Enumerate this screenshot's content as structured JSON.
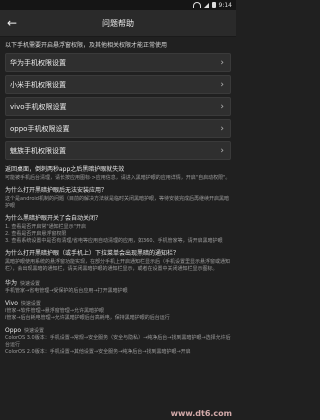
{
  "statusbar": {
    "time": "9:14"
  },
  "appbar": {
    "title": "问题帮助"
  },
  "intro": "以下手机需要开启悬浮窗权限，及其他相关权限才能正常使用",
  "settings": [
    {
      "label": "华为手机权限设置"
    },
    {
      "label": "小米手机权限设置"
    },
    {
      "label": "vivo手机权限设置"
    },
    {
      "label": "oppo手机权限设置"
    },
    {
      "label": "魅族手机权限设置"
    }
  ],
  "faq": [
    {
      "q": "返回桌面，倒刺两秒app之后黑暗护眼就失效",
      "a": "可能被手机后台清理，请长按应用图标·>应用信息，请进入黑暗护眼的应用详情，开启\"自启动权限\"。"
    },
    {
      "q": "为什么打开黑暗护眼后无法安装应用？",
      "a": "这个是android机制的问题（目前的解决方法就是临时关闭黑暗护眼，等待安装完成后再继续开启黑暗护眼"
    },
    {
      "q": "为什么黑暗护眼开关了会自动关闭？",
      "a": "1. 查看是否开启常\"通知栏显示\"开启\n2. 查看是否开启悬浮窗权限\n3. 查看系统设置中是否有清理/省电等应用自动清理的应用，如360、手机管家等，请开启黑暗护眼"
    },
    {
      "q": "为什么打开黑暗护眼（或手机上）下拉菜单会出现黑暗的通知栏？",
      "a": "黑暗护眼使用系统的悬浮窗功能实现，在部分手机上开启通知栏显示后（手机设置里显示悬浮窗或通知栏），会出现黑暗的通知栏，请关闭黑暗护眼的通知栏显示，或者在设置中关闭通知栏显示图标。"
    }
  ],
  "sections": [
    {
      "title": "华为",
      "sub": "快速设置",
      "text": "手机管家→省电管理→受保护的后台应用→打开黑暗护眼"
    },
    {
      "title": "Vivo",
      "sub": "快速设置",
      "text": "i管家→软件管理→悬浮窗管理→允许黑暗护眼\ni管家→后台耗电管理→允许黑暗护眼后台高耗电，保持黑暗护眼的后台运行"
    },
    {
      "title": "Oppo",
      "sub": "快速设置",
      "text": "ColorOS 3.0版本：手机设置→常规→安全服务（安全与隐私）→纯净后台→找到黑暗护眼→选择允许后台运行\nColorOS 2.0版本：手机设置→其他设置→安全服务→纯净后台→找到黑暗护眼→开启"
    }
  ],
  "watermark": "www.dt6.com"
}
